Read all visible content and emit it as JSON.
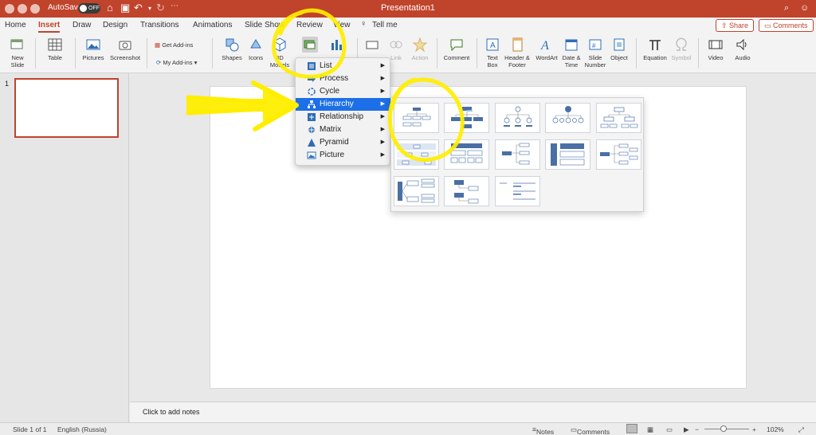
{
  "titlebar": {
    "autosave_label": "AutoSave",
    "autosave_state": "OFF",
    "document_title": "Presentation1"
  },
  "tabs": [
    {
      "label": "Home"
    },
    {
      "label": "Insert",
      "active": true
    },
    {
      "label": "Draw"
    },
    {
      "label": "Design"
    },
    {
      "label": "Transitions"
    },
    {
      "label": "Animations"
    },
    {
      "label": "Slide Show"
    },
    {
      "label": "Review"
    },
    {
      "label": "View"
    },
    {
      "label": "Tell me"
    }
  ],
  "tab_actions": {
    "share": "Share",
    "comments": "Comments"
  },
  "ribbon": {
    "new_slide": "New Slide",
    "table": "Table",
    "pictures": "Pictures",
    "screenshot": "Screenshot",
    "get_addins": "Get Add-ins",
    "my_addins": "My Add-ins",
    "shapes": "Shapes",
    "icons": "Icons",
    "models_3d": "3D Models",
    "link": "Link",
    "action": "Action",
    "comment": "Comment",
    "text_box": "Text Box",
    "header_footer": "Header & Footer",
    "wordart": "WordArt",
    "date_time": "Date & Time",
    "slide_number": "Slide Number",
    "object": "Object",
    "equation": "Equation",
    "symbol": "Symbol",
    "video": "Video",
    "audio": "Audio"
  },
  "thumbnails": {
    "slide_number": "1"
  },
  "smartart_menu": {
    "items": [
      {
        "label": "List"
      },
      {
        "label": "Process"
      },
      {
        "label": "Cycle"
      },
      {
        "label": "Hierarchy",
        "highlighted": true
      },
      {
        "label": "Relationship"
      },
      {
        "label": "Matrix"
      },
      {
        "label": "Pyramid"
      },
      {
        "label": "Picture"
      }
    ]
  },
  "notes": {
    "placeholder": "Click to add notes"
  },
  "status": {
    "slide_indicator": "Slide 1 of 1",
    "language": "English (Russia)",
    "notes_label": "Notes",
    "comments_label": "Comments",
    "zoom": "102%"
  },
  "colors": {
    "accent": "#c0432c",
    "menu_highlight": "#1d6fe8",
    "annotation": "#ffee00"
  }
}
